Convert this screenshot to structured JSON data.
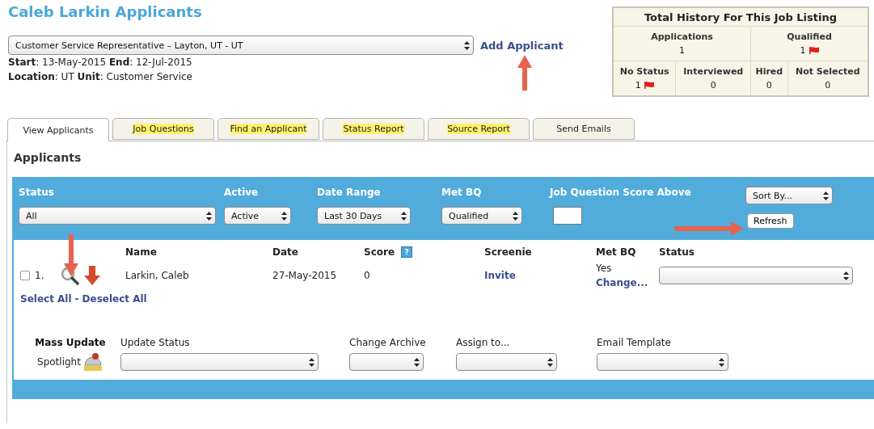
{
  "title": "Caleb Larkin Applicants",
  "job_select": {
    "value": "Customer Service Representative – Layton, UT - UT"
  },
  "add_applicant": "Add Applicant",
  "info_lines": [
    "**Start**: 13-May-2015 **End**: 12-Jul-2015",
    "**Location**: UT **Unit**: Customer Service"
  ],
  "history": {
    "title": "Total History For This Job Listing",
    "top": [
      {
        "label": "Applications",
        "value": "1",
        "flag": false
      },
      {
        "label": "Qualified",
        "value": "1",
        "flag": true
      }
    ],
    "bottom": [
      {
        "label": "No Status",
        "value": "1",
        "flag": true
      },
      {
        "label": "Interviewed",
        "value": "0",
        "flag": false
      },
      {
        "label": "Hired",
        "value": "0",
        "flag": false
      },
      {
        "label": "Not Selected",
        "value": "0",
        "flag": false
      }
    ]
  },
  "tabs": [
    {
      "label": "View Applicants",
      "selected": true,
      "highlighted": false
    },
    {
      "label": "Job Questions",
      "selected": false,
      "highlighted": true
    },
    {
      "label": "Find an Applicant",
      "selected": false,
      "highlighted": true
    },
    {
      "label": "Status Report",
      "selected": false,
      "highlighted": true
    },
    {
      "label": "Source Report",
      "selected": false,
      "highlighted": true
    },
    {
      "label": "Send Emails",
      "selected": false,
      "highlighted": false
    }
  ],
  "section_title": "Applicants",
  "filters": [
    {
      "kind": "select",
      "label": "Status",
      "value": "All"
    },
    {
      "kind": "select",
      "label": "Active",
      "value": "Active"
    },
    {
      "kind": "select",
      "label": "Date Range",
      "value": "Last 30 Days"
    },
    {
      "kind": "select",
      "label": "Met BQ",
      "value": "Qualified"
    },
    {
      "kind": "input",
      "label": "Job Question Score Above"
    }
  ],
  "sort_select": {
    "value": "Sort By..."
  },
  "refresh": "Refresh",
  "columns": [
    {
      "label": "Name"
    },
    {
      "label": "Date"
    },
    {
      "label": "Score",
      "help": "?"
    },
    {
      "label": "Screenie"
    },
    {
      "label": "Met BQ"
    },
    {
      "label": "Status"
    }
  ],
  "rows": [
    {
      "checked": false,
      "number": "1.",
      "name": "Larkin, Caleb",
      "date": "27-May-2015",
      "score": "0",
      "screenie": "Invite",
      "met_bq": "Yes",
      "change": "Change..."
    }
  ],
  "select_links": {
    "select_all": "Select All",
    "separator": "-",
    "deselect_all": "Deselect All"
  },
  "mass_update": {
    "title": "Mass Update",
    "spotlight": "Spotlight",
    "fields": [
      {
        "label": "Update Status"
      },
      {
        "label": "Change Archive"
      },
      {
        "label": "Assign to..."
      },
      {
        "label": "Email Template"
      }
    ]
  }
}
